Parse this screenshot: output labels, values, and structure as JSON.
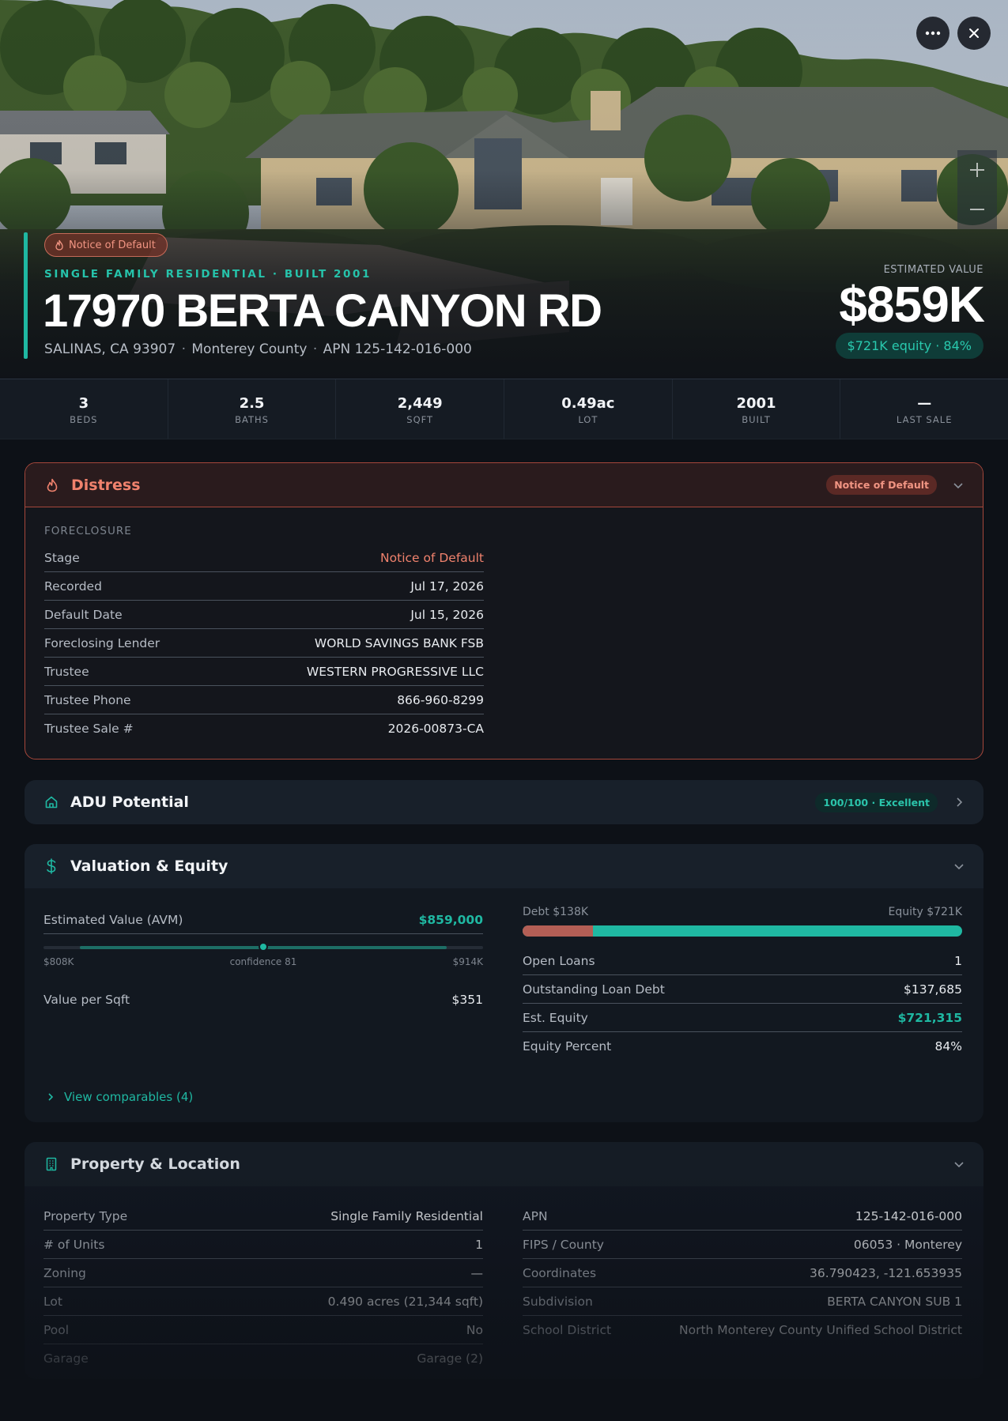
{
  "hero": {
    "badge": "Notice of Default",
    "eyebrow": "SINGLE FAMILY RESIDENTIAL · BUILT 2001",
    "title": "17970 BERTA CANYON RD",
    "address": "SALINAS, CA 93907",
    "county": "Monterey County",
    "apn": "APN 125-142-016-000",
    "estimated_label": "ESTIMATED VALUE",
    "estimated_value": "$859K",
    "equity_pill": "$721K equity · 84%",
    "more_icon": "more-horizontal-icon",
    "close_icon": "close-icon"
  },
  "stats": [
    {
      "value": "3",
      "label": "BEDS"
    },
    {
      "value": "2.5",
      "label": "BATHS"
    },
    {
      "value": "2,449",
      "label": "SQFT"
    },
    {
      "value": "0.49ac",
      "label": "LOT"
    },
    {
      "value": "2001",
      "label": "BUILT"
    },
    {
      "value": "—",
      "label": "LAST SALE"
    }
  ],
  "distress": {
    "title": "Distress",
    "tag": "Notice of Default",
    "section_label": "FORECLOSURE",
    "rows": [
      {
        "k": "Stage",
        "v": "Notice of Default"
      },
      {
        "k": "Recorded",
        "v": "Jul 17, 2026"
      },
      {
        "k": "Default Date",
        "v": "Jul 15, 2026"
      },
      {
        "k": "Foreclosing Lender",
        "v": "WORLD SAVINGS BANK FSB"
      },
      {
        "k": "Trustee",
        "v": "WESTERN PROGRESSIVE LLC"
      },
      {
        "k": "Trustee Phone",
        "v": "866-960-8299"
      },
      {
        "k": "Trustee Sale #",
        "v": "2026-00873-CA"
      }
    ]
  },
  "adu": {
    "title": "ADU Potential",
    "tag": "100/100 · Excellent"
  },
  "valuation": {
    "title": "Valuation & Equity",
    "avm_label": "Estimated Value (AVM)",
    "avm_value": "$859,000",
    "range_low": "$808K",
    "range_high": "$914K",
    "confidence": "confidence 81",
    "avm_position": 0.5,
    "value_per_sqft_label": "Value per Sqft",
    "value_per_sqft": "$351",
    "debt_label": "Debt $138K",
    "equity_label": "Equity $721K",
    "debt_fraction": 0.16,
    "rows": [
      {
        "k": "Open Loans",
        "v": "1"
      },
      {
        "k": "Outstanding Loan Debt",
        "v": "$137,685"
      },
      {
        "k": "Est. Equity",
        "v": "$721,315"
      },
      {
        "k": "Equity Percent",
        "v": "84%"
      }
    ],
    "comparables_link": "View comparables (4)"
  },
  "property": {
    "title": "Property & Location",
    "left_rows": [
      {
        "k": "Property Type",
        "v": "Single Family Residential"
      },
      {
        "k": "# of Units",
        "v": "1"
      },
      {
        "k": "Zoning",
        "v": "—"
      },
      {
        "k": "Lot",
        "v": "0.490 acres (21,344 sqft)"
      },
      {
        "k": "Pool",
        "v": "No"
      },
      {
        "k": "Garage",
        "v": "Garage (2)"
      }
    ],
    "right_rows": [
      {
        "k": "APN",
        "v": "125-142-016-000"
      },
      {
        "k": "FIPS / County",
        "v": "06053 · Monterey"
      },
      {
        "k": "Coordinates",
        "v": "36.790423, -121.653935"
      },
      {
        "k": "Subdivision",
        "v": "BERTA CANYON SUB 1"
      },
      {
        "k": "School District",
        "v": "North Monterey County Unified School District"
      }
    ]
  },
  "colors": {
    "accent_teal": "#1fb8a2",
    "distress_red": "#f0826d",
    "debt_bar": "#b35e55",
    "equity_bar": "#1fb8a2"
  }
}
